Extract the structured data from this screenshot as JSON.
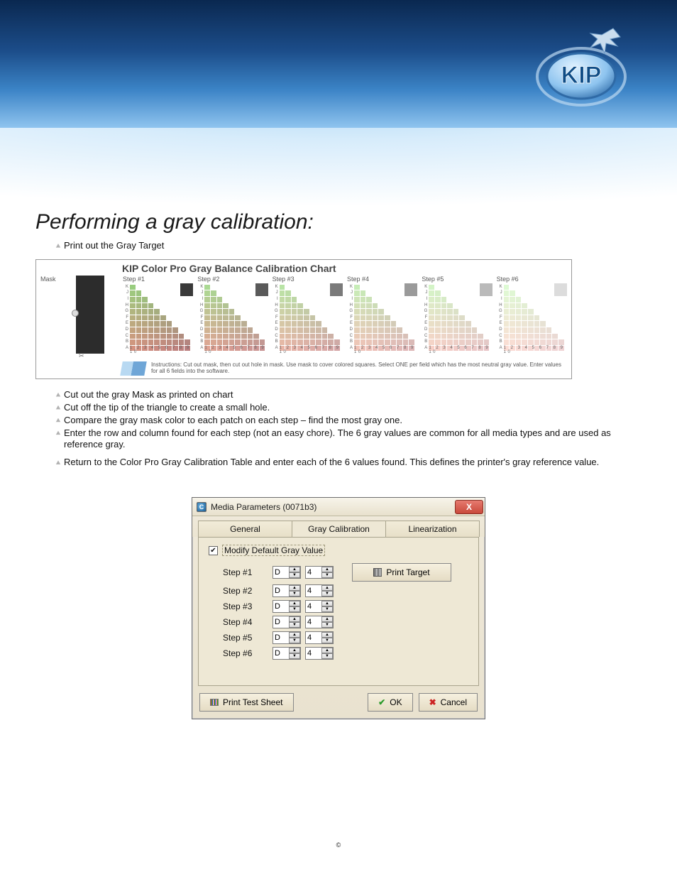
{
  "logo_text": "KIP",
  "section_title": "Performing a gray calibration:",
  "intro_bullet": "Print out the Gray Target",
  "chart": {
    "title": "KIP Color Pro Gray Balance Calibration Chart",
    "mask_label": "Mask",
    "row_letters": [
      "K",
      "J",
      "I",
      "H",
      "G",
      "F",
      "E",
      "D",
      "C",
      "B",
      "A"
    ],
    "col_numbers": "1  2  3  4  5  6  7  8  9  10",
    "steps": [
      {
        "label": "Step #1",
        "ref_hex": "#3a3a3a"
      },
      {
        "label": "Step #2",
        "ref_hex": "#5a5a5a"
      },
      {
        "label": "Step #3",
        "ref_hex": "#7a7a7a"
      },
      {
        "label": "Step #4",
        "ref_hex": "#9a9a9a"
      },
      {
        "label": "Step #5",
        "ref_hex": "#bababa"
      },
      {
        "label": "Step #6",
        "ref_hex": "#dcdcdc"
      }
    ],
    "instructions": "Instructions: Cut out mask, then cut out hole in mask. Use mask to cover colored squares. Select ONE per field which has the most neutral gray value. Enter values for all 6 fields into the software."
  },
  "post_chart": [
    "Cut out the gray Mask as printed on chart",
    "Cut off the tip of the triangle to create a small hole.",
    "Compare the gray mask color to each patch on each step – find the most gray one.",
    "Enter the row and column found for each step (not an easy chore). The 6 gray values are common for all media types and are used as reference gray.",
    "Return to the Color Pro Gray Calibration Table and enter each of the 6 values found. This defines the printer's gray reference value."
  ],
  "dialog": {
    "title": "Media Parameters (0071b3)",
    "tabs": {
      "general": "General",
      "gray": "Gray Calibration",
      "linear": "Linearization"
    },
    "checkbox_label": "Modify Default Gray Value",
    "checkbox_checked": true,
    "steps": [
      {
        "label": "Step #1",
        "letter": "D",
        "number": "4"
      },
      {
        "label": "Step #2",
        "letter": "D",
        "number": "4"
      },
      {
        "label": "Step #3",
        "letter": "D",
        "number": "4"
      },
      {
        "label": "Step #4",
        "letter": "D",
        "number": "4"
      },
      {
        "label": "Step #5",
        "letter": "D",
        "number": "4"
      },
      {
        "label": "Step #6",
        "letter": "D",
        "number": "4"
      }
    ],
    "print_target": "Print Target",
    "print_test_sheet": "Print Test Sheet",
    "ok": "OK",
    "cancel": "Cancel"
  },
  "footer_copyright": "©"
}
